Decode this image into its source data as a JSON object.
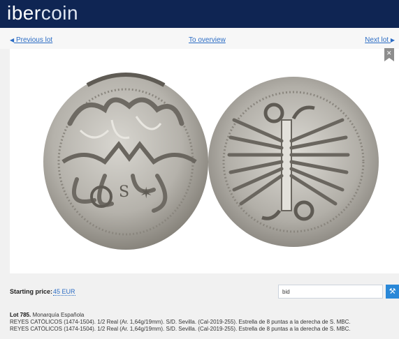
{
  "header": {
    "logo_a": "iber",
    "logo_b": "coin"
  },
  "nav": {
    "prev_label": "Previous lot",
    "overview_label": "To overview",
    "next_label": "Next lot"
  },
  "lot": {
    "starting_price_label": "Starting price:",
    "starting_price_value": "45 EUR",
    "bid_value": "bid",
    "number": "Lot 785.",
    "category": "Monarquía Española",
    "line1": "REYES CATÓLICOS (1474-1504). 1/2 Real (Ar. 1,64g/19mm). S/D. Sevilla. (Cal-2019-255). Estrella de 8 puntas a la derecha de S. MBC.",
    "line2": "REYES CATÓLICOS (1474-1504). 1/2 Real (Ar. 1,64g/19mm). S/D. Sevilla. (Cal-2019-255). Estrella de 8 puntas a la derecha de S. MBC."
  },
  "icons": {
    "bookmark": "bookmark-icon",
    "hammer": "hammer-icon",
    "prev_arrow": "triangle-left",
    "next_arrow": "triangle-right"
  },
  "colors": {
    "header": "#0f2553",
    "link": "#2b6cc4",
    "bid_button": "#2a88d8",
    "bookmark": "#8d8d8d"
  }
}
